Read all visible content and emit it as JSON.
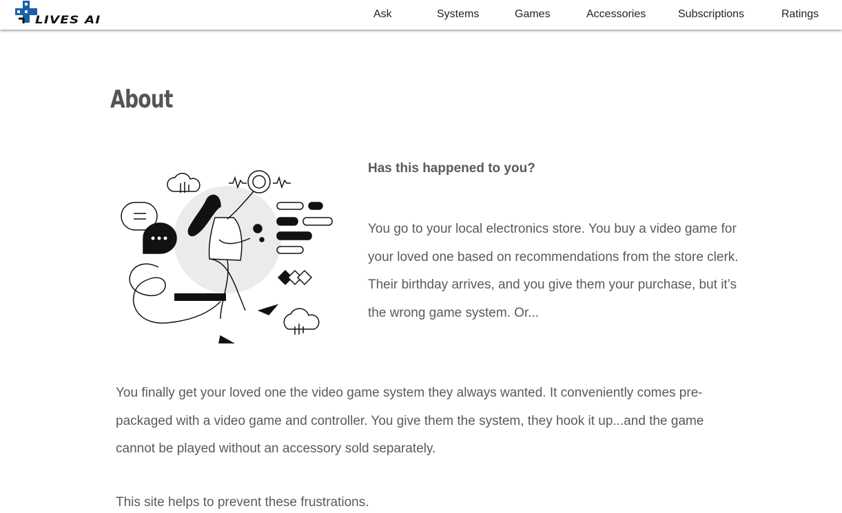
{
  "header": {
    "logo_text": "LIVES AI",
    "nav": [
      "Ask",
      "Systems",
      "Games",
      "Accessories",
      "Subscriptions",
      "Ratings"
    ]
  },
  "main": {
    "title": "About",
    "question": "Has this happened to you?",
    "paragraph1": "You go to your local electronics store. You buy a video game for your loved one based on recommendations from the store clerk. Their birthday arrives, and you give them your purchase, but it’s the wrong game system. Or...",
    "paragraph2": "You finally get your loved one the video game system they always wanted. It conveniently comes pre-packaged with a video game and controller. You give them the system, they hook it up...and the game cannot be played without an accessory sold separately.",
    "paragraph3": "This site helps to prevent these frustrations."
  },
  "colors": {
    "logo_blue": "#1b5fa8",
    "text": "#5a5a5a"
  }
}
